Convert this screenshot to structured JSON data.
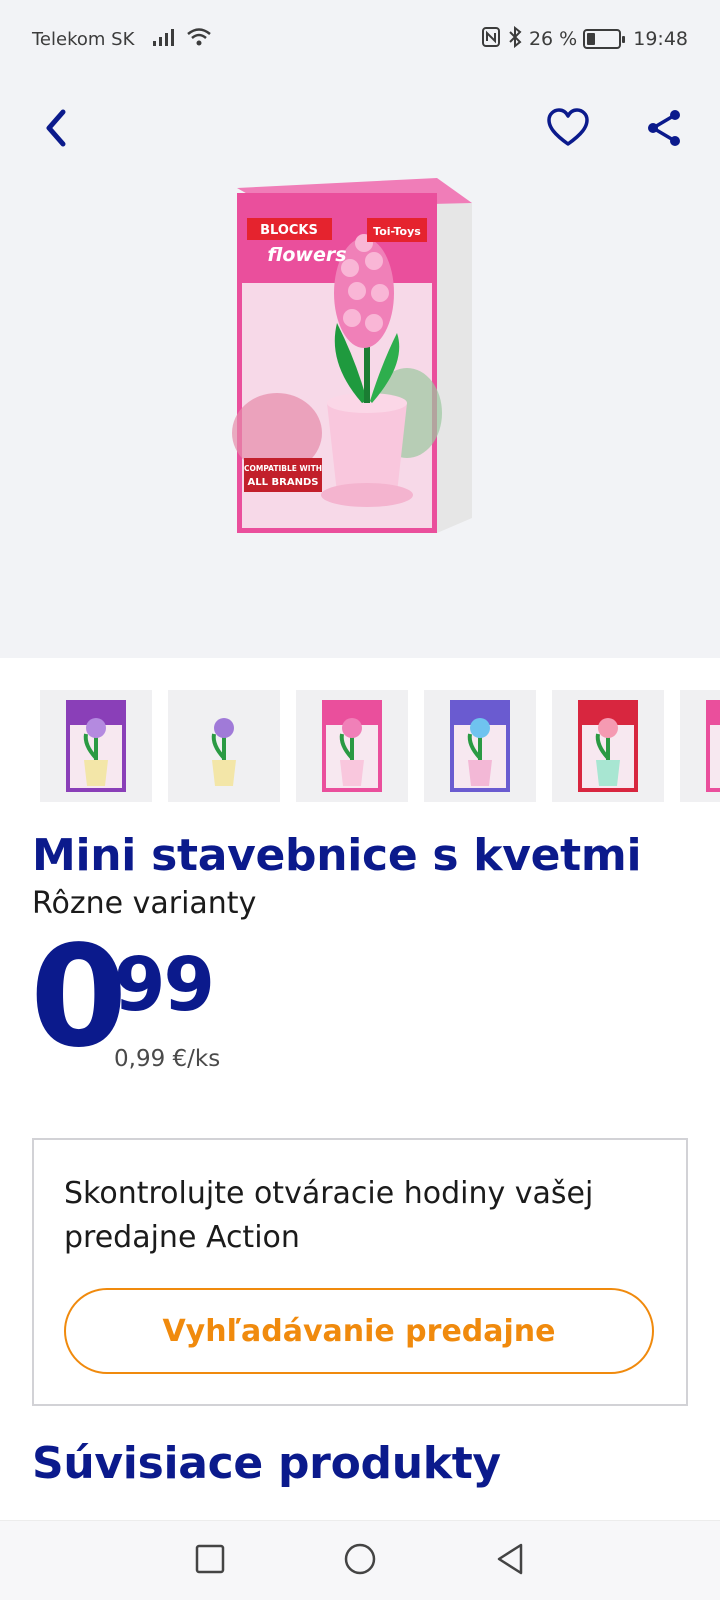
{
  "status_bar": {
    "carrier": "Telekom SK",
    "battery_text": "26 %",
    "battery_level": 0.26,
    "time": "19:48",
    "icons": [
      "signal-icon",
      "wifi-icon",
      "nfc-icon",
      "bluetooth-icon",
      "battery-icon"
    ]
  },
  "header": {
    "icons": [
      "back-arrow-icon",
      "heart-icon",
      "share-icon"
    ]
  },
  "product": {
    "box_brand": "BLOCKS",
    "box_line": "flowers",
    "box_maker": "Toi-Toys",
    "box_claim_1": "COMPATIBLE WITH",
    "box_claim_2": "ALL BRANDS",
    "title": "Mini stavebnice s kvetmi",
    "subtitle": "Rôzne varianty",
    "price_int": "0",
    "price_dec": "99",
    "unit_price": "0,99 €/ks"
  },
  "thumbnails": [
    {
      "variant": "purple-box-yellow-pot",
      "active": false
    },
    {
      "variant": "purple-flowers-yellow-pot",
      "active": false
    },
    {
      "variant": "pink-box-hyacinth",
      "active": true
    },
    {
      "variant": "blue-box-blue-flower",
      "active": false
    },
    {
      "variant": "red-box-mint-pot",
      "active": false
    },
    {
      "variant": "pink-box-partial",
      "active": false
    }
  ],
  "store": {
    "text": "Skontrolujte otváracie hodiny vašej predajne Action",
    "button_label": "Vyhľadávanie predajne"
  },
  "related": {
    "title": "Súvisiace produkty"
  },
  "colors": {
    "brand_blue": "#0b1a8c",
    "accent_orange": "#f08a0d",
    "hero_bg": "#f2f3f6"
  },
  "nav": {
    "icons": [
      "recent-apps-icon",
      "home-icon",
      "back-icon"
    ]
  }
}
